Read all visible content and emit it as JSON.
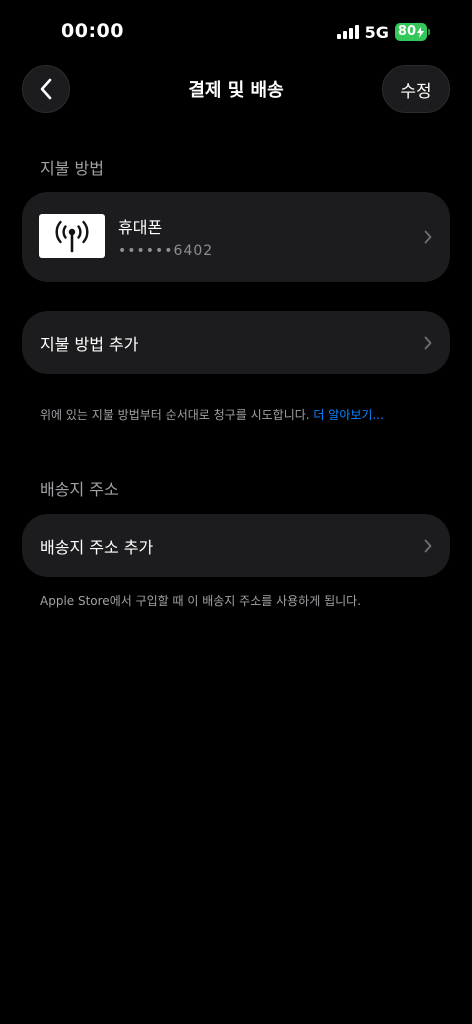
{
  "status_bar": {
    "time": "00:00",
    "network": "5G",
    "battery": "80"
  },
  "nav": {
    "title": "결제 및 배송",
    "edit_label": "수정"
  },
  "payment_section": {
    "header": "지불 방법",
    "method": {
      "name": "휴대폰",
      "number": "••••••6402"
    },
    "add_label": "지불 방법 추가",
    "footnote": "위에 있는 지불 방법부터 순서대로 청구를 시도합니다.",
    "learn_more": "더 알아보기..."
  },
  "shipping_section": {
    "header": "배송지 주소",
    "add_label": "배송지 주소 추가",
    "footnote": "Apple Store에서 구입할 때 이 배송지 주소를 사용하게 됩니다."
  },
  "colors": {
    "background": "#000000",
    "card": "#1c1c1e",
    "link": "#0a84ff",
    "battery": "#34c759",
    "secondary_text": "#a1a1a6"
  }
}
